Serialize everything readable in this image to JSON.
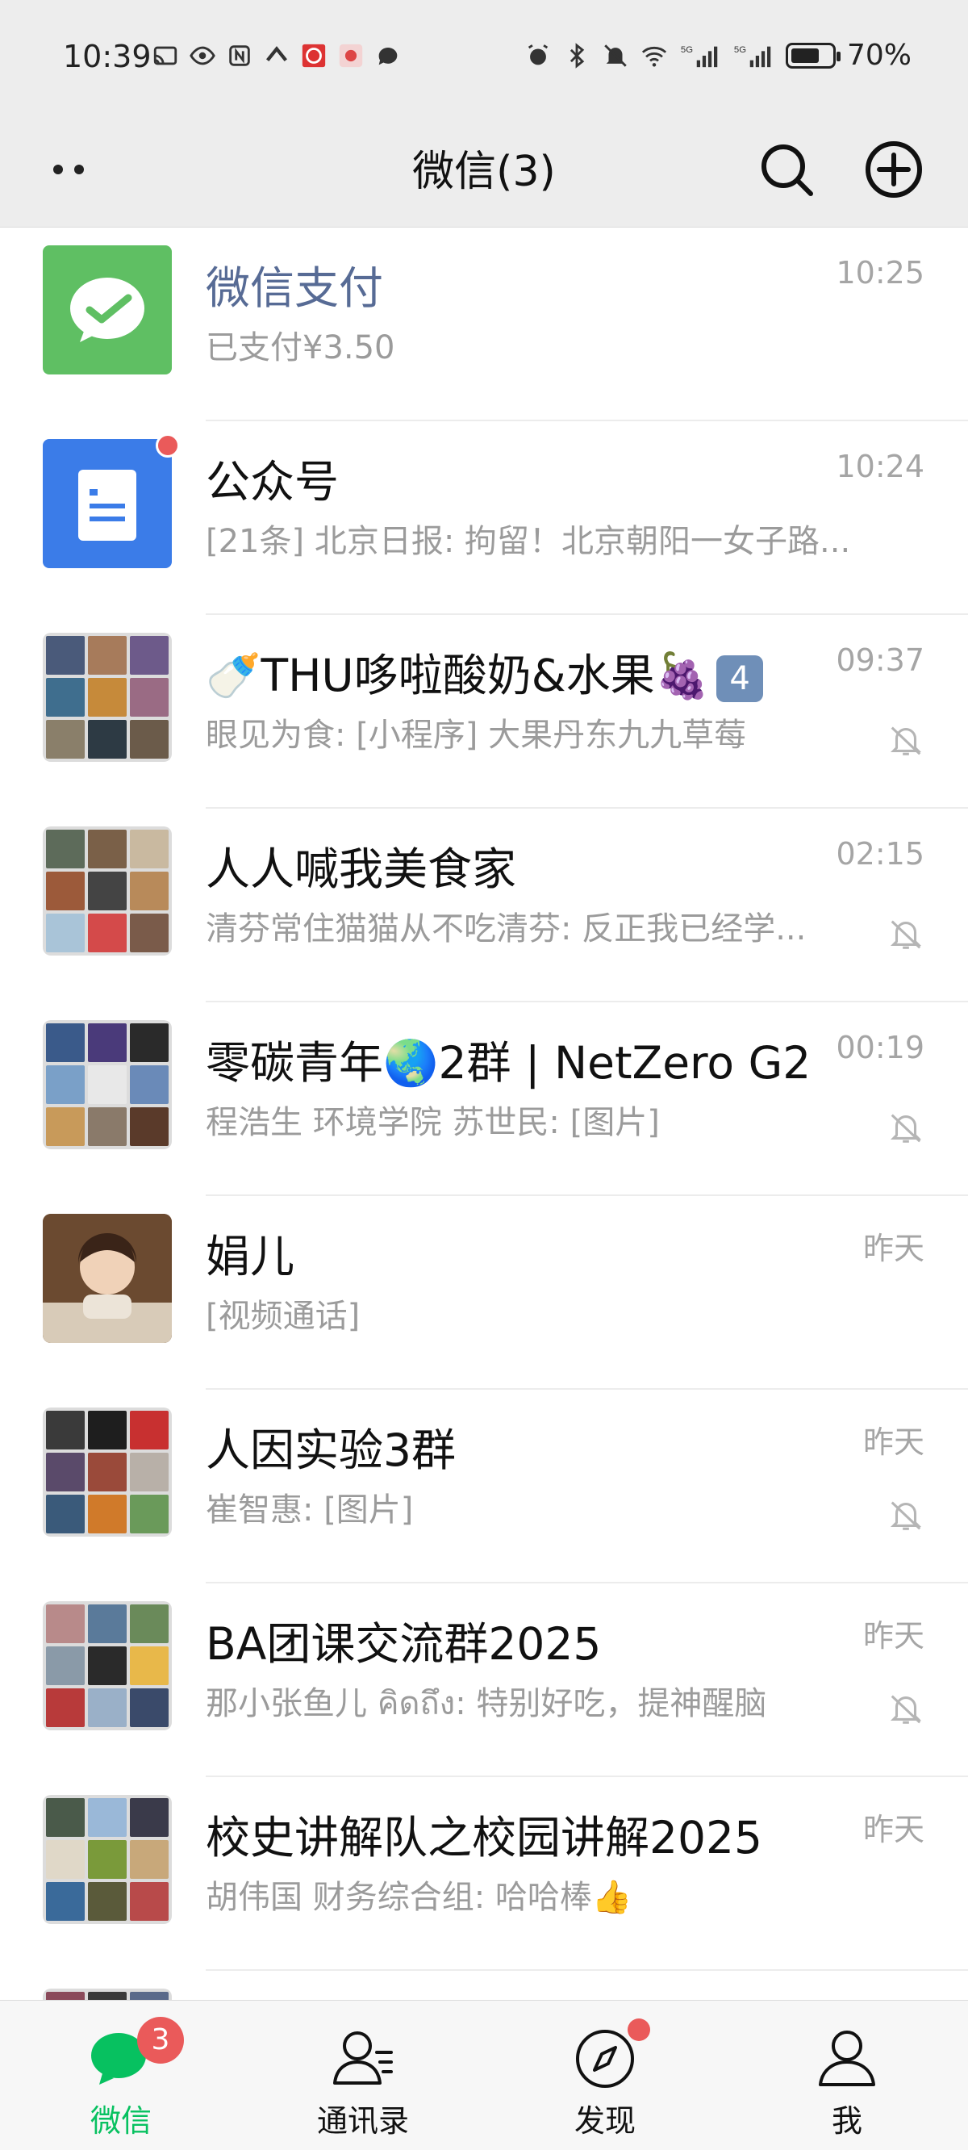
{
  "status_bar": {
    "time": "10:39",
    "battery": "70%",
    "net1": "5G",
    "net2": "5G"
  },
  "header": {
    "title": "微信(3)",
    "search_icon": "search-icon",
    "add_icon": "plus-circle-icon"
  },
  "chats": [
    {
      "name": "微信支付",
      "preview": "已支付¥3.50",
      "time": "10:25",
      "muted": false
    },
    {
      "name": "公众号",
      "preview": "[21条] 北京日报: 拘留！北京朝阳一女子路...",
      "time": "10:24",
      "muted": false,
      "unread_dot": true
    },
    {
      "name": "🍼THU哆啦酸奶&水果🍇",
      "name_badge": "4",
      "preview": "眼见为食: [小程序] 大果丹东九九草莓",
      "time": "09:37",
      "muted": true
    },
    {
      "name": "人人喊我美食家",
      "preview": "清芬常住猫猫从不吃清芬: 反正我已经学...",
      "time": "02:15",
      "muted": true
    },
    {
      "name": "零碳青年🌏2群 | NetZero G2",
      "preview": "程浩生 环境学院 苏世民: [图片]",
      "time": "00:19",
      "muted": true
    },
    {
      "name": "娟儿",
      "preview": "[视频通话]",
      "time": "昨天",
      "muted": false
    },
    {
      "name": "人因实验3群",
      "preview": "崔智惠: [图片]",
      "time": "昨天",
      "muted": true
    },
    {
      "name": "BA团课交流群2025",
      "preview": "那小张鱼儿 คิดถึง: 特别好吃，提神醒脑",
      "time": "昨天",
      "muted": true
    },
    {
      "name": "校史讲解队之校园讲解2025",
      "preview": "胡伟国 财务综合组: 哈哈棒👍",
      "time": "昨天",
      "muted": false
    }
  ],
  "tabs": [
    {
      "label": "微信",
      "badge": "3"
    },
    {
      "label": "通讯录"
    },
    {
      "label": "发现"
    },
    {
      "label": "我"
    }
  ],
  "colors": {
    "accent": "#07c160",
    "service_name": "#576b95",
    "badge": "#ea5a5a",
    "wechat_pay": "#5fbf63",
    "official_accounts": "#3b7ce8"
  }
}
